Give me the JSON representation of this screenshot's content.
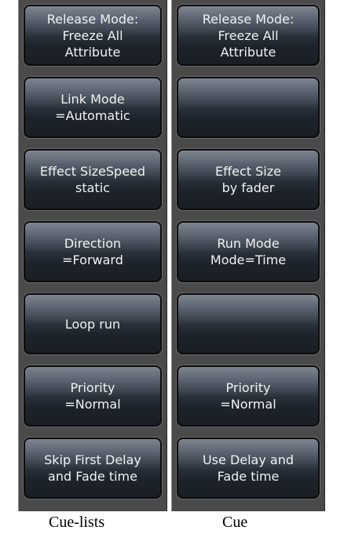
{
  "panels": {
    "cue_lists": {
      "caption": "Cue-lists",
      "buttons": [
        {
          "label": "Release Mode:\nFreeze All\nAttribute"
        },
        {
          "label": "Link Mode\n=Automatic"
        },
        {
          "label": "Effect SizeSpeed\nstatic"
        },
        {
          "label": "Direction\n=Forward"
        },
        {
          "label": "Loop run"
        },
        {
          "label": "Priority\n=Normal"
        },
        {
          "label": "Skip First Delay\nand Fade time"
        }
      ]
    },
    "cue": {
      "caption": "Cue",
      "buttons": [
        {
          "label": "Release Mode:\nFreeze All\nAttribute"
        },
        {
          "label": ""
        },
        {
          "label": "Effect Size\nby fader"
        },
        {
          "label": "Run Mode\nMode=Time"
        },
        {
          "label": ""
        },
        {
          "label": "Priority\n=Normal"
        },
        {
          "label": "Use Delay and\nFade time"
        }
      ]
    }
  }
}
